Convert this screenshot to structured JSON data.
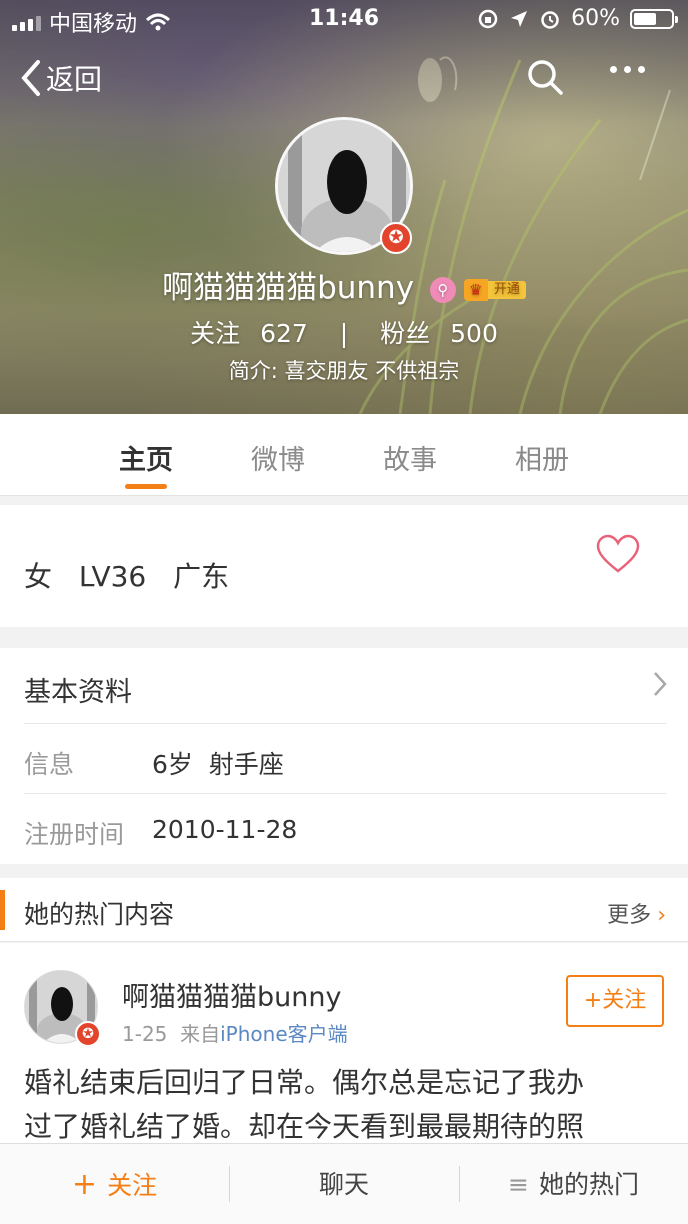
{
  "status_bar": {
    "carrier": "中国移动",
    "time": "11:46",
    "battery_percent": "60%",
    "battery_level": 0.6
  },
  "nav": {
    "back_label": "返回",
    "search_icon": "search-icon",
    "more_icon": "more-icon"
  },
  "profile": {
    "username": "啊猫猫猫猫bunny",
    "vip_label": "开通",
    "following_label": "关注",
    "following_count": "627",
    "separator": "|",
    "followers_label": "粉丝",
    "followers_count": "500",
    "bio": "简介: 喜交朋友 不供祖宗"
  },
  "tabs": [
    {
      "label": "主页",
      "active": true
    },
    {
      "label": "微博",
      "active": false
    },
    {
      "label": "故事",
      "active": false
    },
    {
      "label": "相册",
      "active": false
    }
  ],
  "summary": {
    "gender": "女",
    "level": "LV36",
    "location": "广东"
  },
  "basic_info": {
    "title": "基本资料",
    "rows": [
      {
        "key": "信息",
        "value": "6岁  射手座"
      },
      {
        "key": "注册时间",
        "value": "2010-11-28"
      }
    ]
  },
  "hot_content": {
    "title": "她的热门内容",
    "more_label": "更多"
  },
  "post": {
    "author": "啊猫猫猫猫bunny",
    "date": "1-25",
    "source_prefix": "来自",
    "source": "iPhone客户端",
    "follow_label": "+关注",
    "text_line1": "婚礼结束后回归了日常。偶尔总是忘记了我办",
    "text_line2": "过了婚礼结了婚。却在今天看到最最期待的照"
  },
  "bottom_bar": {
    "follow_label": "关注",
    "chat_label": "聊天",
    "hot_label": "她的热门"
  },
  "colors": {
    "accent": "#f57f17",
    "verified": "#e2452c",
    "link": "#5b88c2",
    "heart": "#e8637a"
  }
}
